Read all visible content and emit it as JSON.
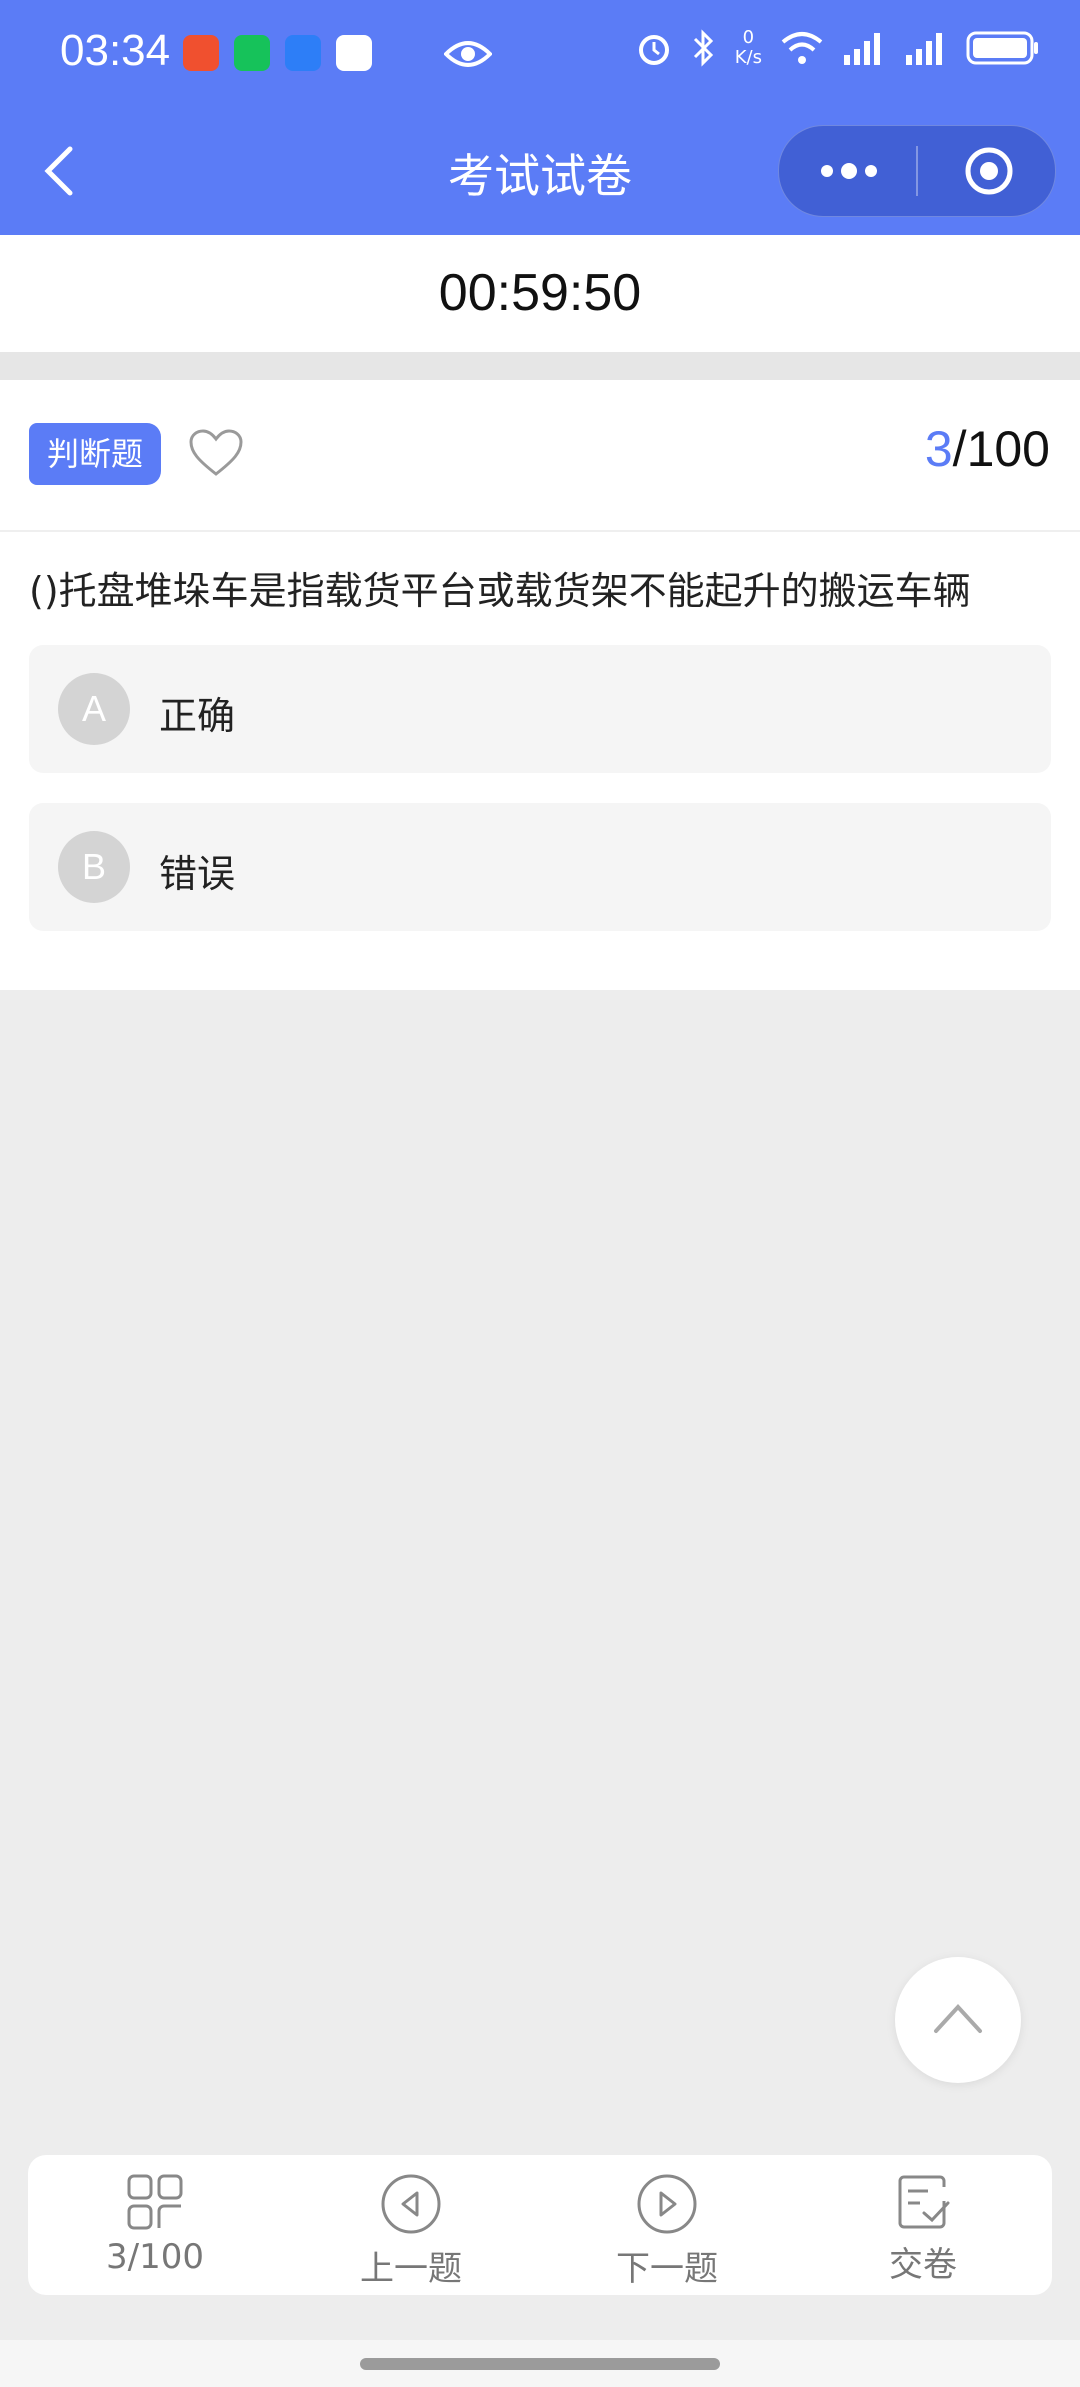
{
  "status_bar": {
    "time": "03:34",
    "net_speed_value": "0",
    "net_speed_unit": "K/s"
  },
  "nav": {
    "title": "考试试卷"
  },
  "timer": {
    "text": "00:59:50"
  },
  "question": {
    "type_label": "判断题",
    "current": "3",
    "total": "/100",
    "text": "()托盘堆垛车是指载货平台或载货架不能起升的搬运车辆",
    "options": [
      {
        "letter": "A",
        "text": "正确"
      },
      {
        "letter": "B",
        "text": "错误"
      }
    ]
  },
  "bottom_bar": {
    "progress_label": "3/100",
    "prev_label": "上一题",
    "next_label": "下一题",
    "submit_label": "交卷"
  },
  "colors": {
    "accent": "#5b7cf6",
    "background": "#ededed"
  },
  "icons": [
    "back-icon",
    "more-icon",
    "target-icon",
    "heart-icon",
    "chevron-up-icon",
    "grid-icon",
    "prev-icon",
    "next-icon",
    "submit-icon"
  ]
}
